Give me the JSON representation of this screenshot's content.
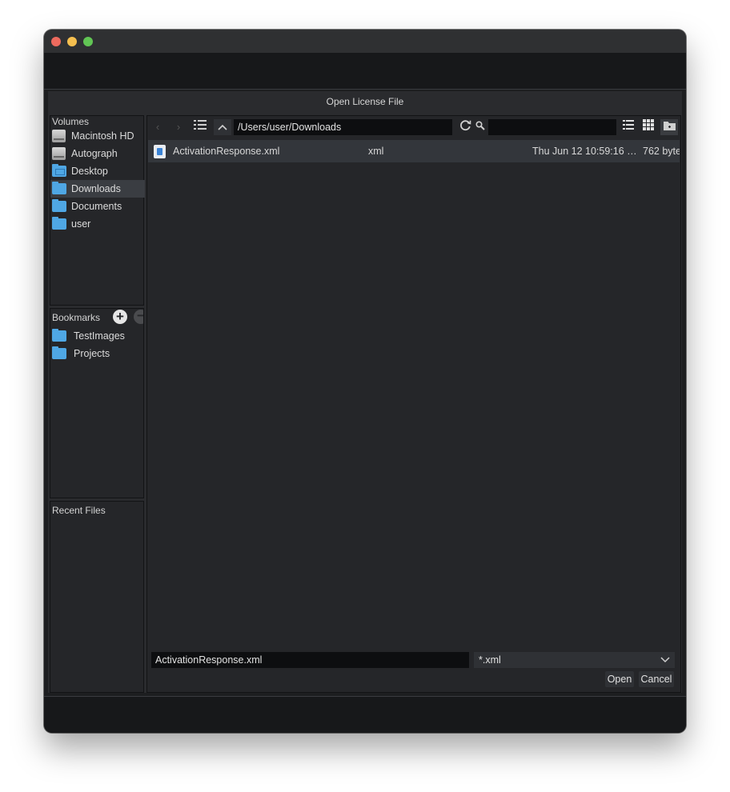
{
  "dialog": {
    "title": "Open License File"
  },
  "sidebar": {
    "volumes_title": "Volumes",
    "volumes": [
      {
        "label": "Macintosh HD",
        "icon": "hard-drive-icon"
      },
      {
        "label": "Autograph",
        "icon": "hard-drive-icon"
      },
      {
        "label": "Desktop",
        "icon": "folder-icon"
      },
      {
        "label": "Downloads",
        "icon": "folder-icon",
        "selected": true
      },
      {
        "label": "Documents",
        "icon": "folder-icon"
      },
      {
        "label": "user",
        "icon": "folder-icon"
      }
    ],
    "bookmarks_title": "Bookmarks",
    "bookmarks": [
      {
        "label": "TestImages",
        "icon": "folder-icon"
      },
      {
        "label": "Projects",
        "icon": "folder-icon"
      }
    ],
    "recent_title": "Recent Files"
  },
  "toolbar": {
    "path": "/Users/user/Downloads",
    "search_value": ""
  },
  "files": [
    {
      "name": "ActivationResponse.xml",
      "type": "xml",
      "date": "Thu Jun 12 10:59:16 …",
      "size": "762 byte"
    }
  ],
  "footer": {
    "filename": "ActivationResponse.xml",
    "filter": "*.xml",
    "open_label": "Open",
    "cancel_label": "Cancel"
  },
  "colors": {
    "accent_folder": "#4fa7e4",
    "background": "#2a2b2e",
    "selection": "#33363b"
  }
}
